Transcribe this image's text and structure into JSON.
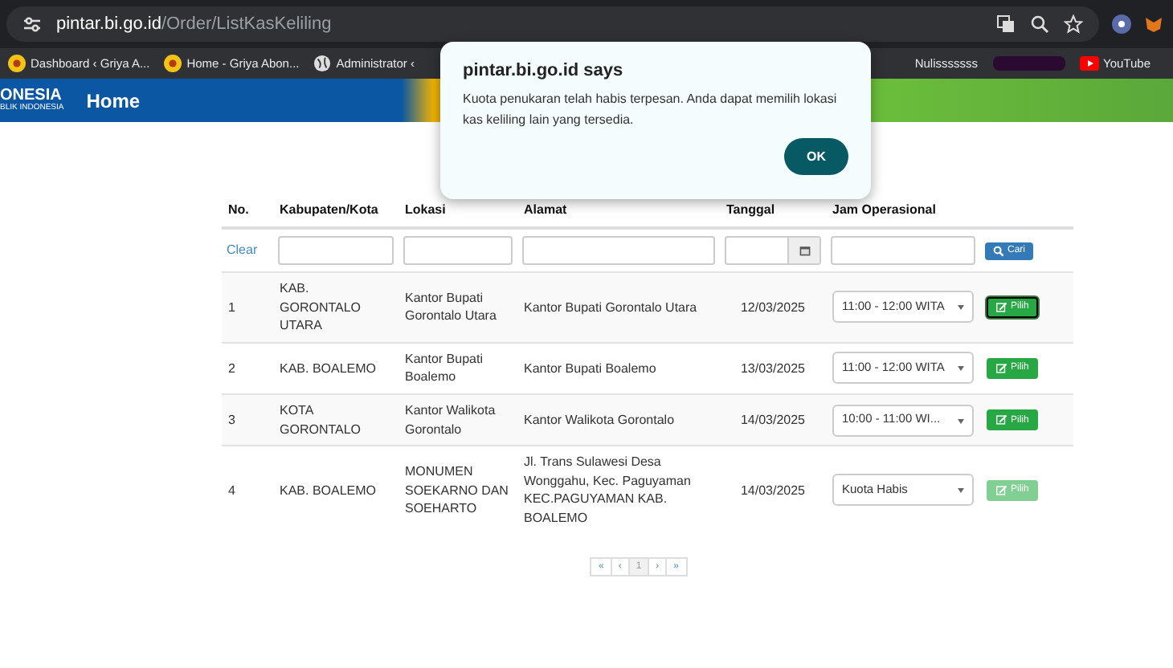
{
  "browser": {
    "url_host": "pintar.bi.go.id",
    "url_path": "/Order/ListKasKeliling",
    "bookmarks": [
      {
        "label": "Dashboard ‹ Griya A...",
        "kind": "logo"
      },
      {
        "label": "Home - Griya Abon...",
        "kind": "logo"
      },
      {
        "label": "Administrator ‹",
        "kind": "globe"
      },
      {
        "label": "Nulisssssss",
        "kind": "none"
      },
      {
        "kind": "redacted"
      },
      {
        "label": "YouTube",
        "kind": "youtube"
      }
    ]
  },
  "site_header": {
    "logo_text": "ONESIA",
    "logo_subtext": "BLIK INDONESIA",
    "nav": "Home"
  },
  "dialog": {
    "title": "pintar.bi.go.id says",
    "message": "Kuota penukaran telah habis terpesan. Anda dapat memilih lokasi kas keliling lain yang tersedia.",
    "button": "OK"
  },
  "table": {
    "columns": [
      "No.",
      "Kabupaten/Kota",
      "Lokasi",
      "Alamat",
      "Tanggal",
      "Jam Operasional"
    ],
    "filter": {
      "clear": "Clear",
      "search_button": "Cari"
    },
    "rows": [
      {
        "no": "1",
        "kabupaten": "KAB. GORONTALO UTARA",
        "lokasi": "Kantor Bupati Gorontalo Utara",
        "alamat": "Kantor Bupati Gorontalo Utara",
        "tanggal": "12/03/2025",
        "jam": "11:00 - 12:00 WITA",
        "action": "Pilih",
        "disabled": false,
        "focused": true
      },
      {
        "no": "2",
        "kabupaten": "KAB. BOALEMO",
        "lokasi": "Kantor Bupati Boalemo",
        "alamat": "Kantor Bupati Boalemo",
        "tanggal": "13/03/2025",
        "jam": "11:00 - 12:00 WITA",
        "action": "Pilih",
        "disabled": false,
        "focused": false
      },
      {
        "no": "3",
        "kabupaten": "KOTA GORONTALO",
        "lokasi": "Kantor Walikota Gorontalo",
        "alamat": "Kantor Walikota Gorontalo",
        "tanggal": "14/03/2025",
        "jam": "10:00 - 11:00 WI...",
        "action": "Pilih",
        "disabled": false,
        "focused": false
      },
      {
        "no": "4",
        "kabupaten": "KAB. BOALEMO",
        "lokasi": "MONUMEN SOEKARNO DAN SOEHARTO",
        "alamat": "Jl. Trans Sulawesi Desa Wonggahu, Kec. Paguyaman KEC.PAGUYAMAN KAB. BOALEMO",
        "tanggal": "14/03/2025",
        "jam": "Kuota Habis",
        "action": "Pilih",
        "disabled": true,
        "focused": false
      }
    ]
  },
  "pagination": [
    {
      "label": "«",
      "selected": false
    },
    {
      "label": "‹",
      "selected": false
    },
    {
      "label": "1",
      "selected": true
    },
    {
      "label": "›",
      "selected": false
    },
    {
      "label": "»",
      "selected": false
    }
  ]
}
